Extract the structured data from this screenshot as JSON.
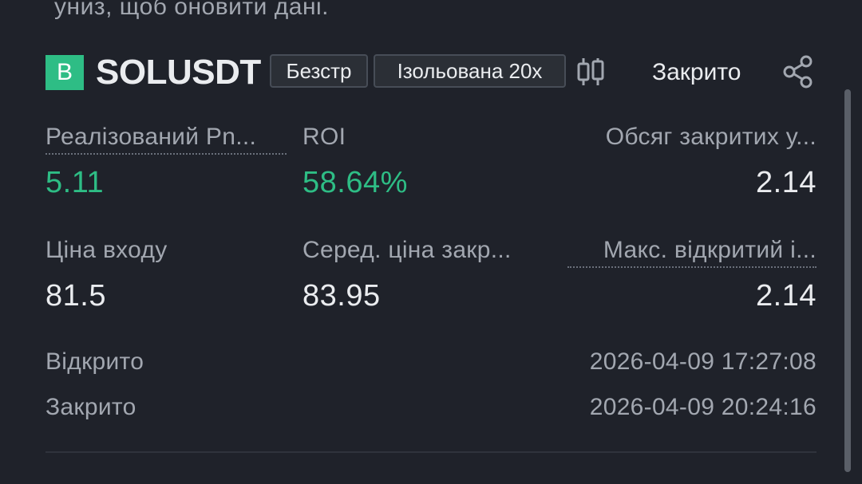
{
  "hint": {
    "text": "униз, щоб оновити дані."
  },
  "header": {
    "side_badge": "B",
    "symbol": "SOLUSDT",
    "tag_contract": "Безстр",
    "tag_margin": "Ізольована 20x",
    "status": "Закрито",
    "icons": {
      "chart": "candlestick-icon",
      "share": "share-icon"
    }
  },
  "stats": {
    "realized_pnl": {
      "label": "Реалізований Pn...",
      "value": "5.11"
    },
    "roi": {
      "label": "ROI",
      "value": "58.64%"
    },
    "closed_volume": {
      "label": "Обсяг закритих у...",
      "value": "2.14"
    },
    "entry_price": {
      "label": "Ціна входу",
      "value": "81.5"
    },
    "avg_close_price": {
      "label": "Серед. ціна закр...",
      "value": "83.95"
    },
    "max_open_interest": {
      "label": "Макс. відкритий і...",
      "value": "2.14"
    }
  },
  "times": {
    "opened": {
      "label": "Відкрито",
      "value": "2026-04-09 17:27:08"
    },
    "closed": {
      "label": "Закрито",
      "value": "2026-04-09 20:24:16"
    }
  },
  "colors": {
    "background": "#1f222a",
    "positive": "#2ebd85",
    "text_primary": "#eaecef",
    "text_secondary": "#a2a7b0"
  }
}
